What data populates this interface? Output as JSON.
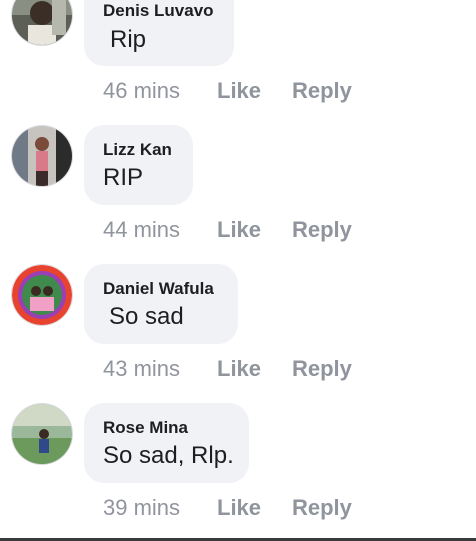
{
  "comments": [
    {
      "author": "Denis Luvavo",
      "text": "Rip",
      "time": "46 mins",
      "like_label": "Like",
      "reply_label": "Reply"
    },
    {
      "author": "Lizz Kan",
      "text": "RIP",
      "time": "44 mins",
      "like_label": "Like",
      "reply_label": "Reply"
    },
    {
      "author": "Daniel Wafula",
      "text": "So sad",
      "time": "43 mins",
      "like_label": "Like",
      "reply_label": "Reply"
    },
    {
      "author": "Rose Mina",
      "text": "So sad, Rlp.",
      "time": "39 mins",
      "like_label": "Like",
      "reply_label": "Reply"
    }
  ],
  "colors": {
    "bubble_bg": "#f0f2f5",
    "meta_text": "#90949c",
    "body_text": "#1c1e21"
  }
}
